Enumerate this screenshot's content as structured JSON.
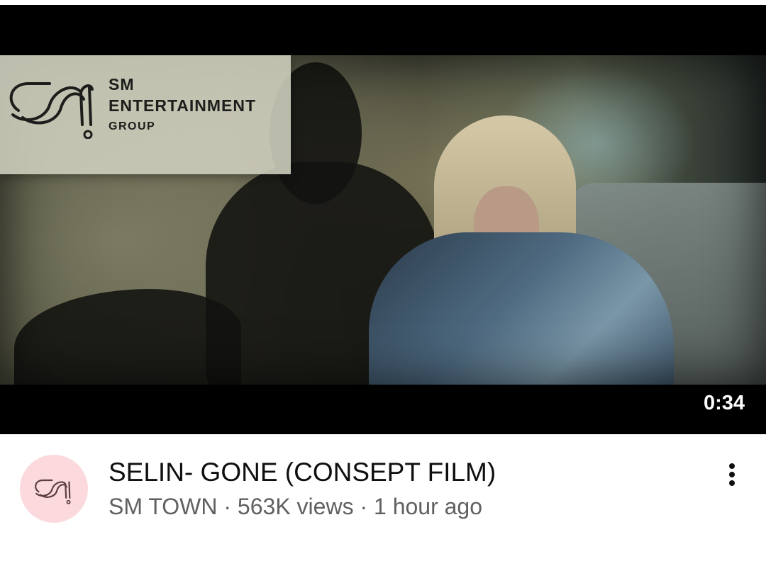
{
  "video": {
    "duration": "0:34",
    "overlay_logo": {
      "line1": "SM",
      "line2": "ENTERTAINMENT",
      "line3": "GROUP"
    }
  },
  "meta": {
    "title": "SELIN- GONE (CONSEPT FILM)",
    "channel": "SM TOWN",
    "separator": " · ",
    "views": "563K views",
    "age": "1 hour ago"
  },
  "icons": {
    "more": "more-vert-icon",
    "avatar": "sm-logo-icon"
  },
  "colors": {
    "avatar_bg": "#fbd9dd",
    "title": "#0f0f0f",
    "subtext": "#606060",
    "duration_text": "#ffffff"
  }
}
